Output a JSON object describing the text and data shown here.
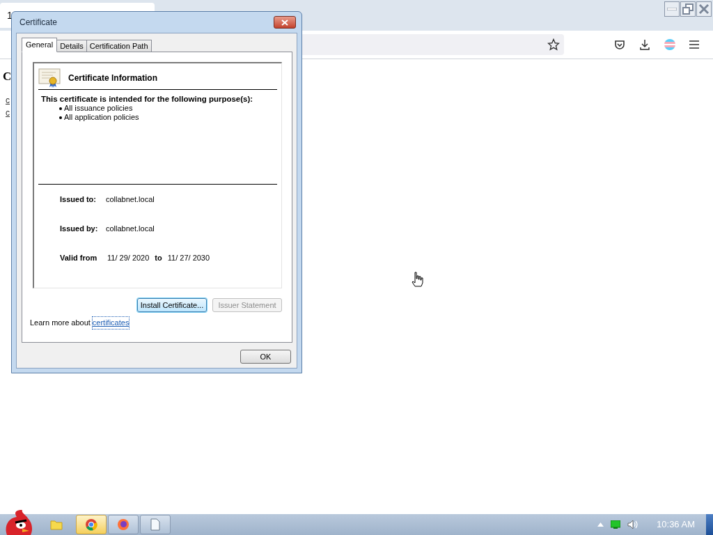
{
  "browser": {
    "tab_title": "1"
  },
  "page": {
    "heading": "C",
    "links": [
      "c",
      "c"
    ]
  },
  "dialog": {
    "title": "Certificate",
    "tabs": [
      {
        "label": "General",
        "selected": true
      },
      {
        "label": "Details",
        "selected": false
      },
      {
        "label": "Certification Path",
        "selected": false
      }
    ],
    "header": "Certificate Information",
    "purpose_heading": "This certificate is intended for the following purpose(s):",
    "purposes": [
      "All issuance policies",
      "All application policies"
    ],
    "fields": [
      {
        "label": "Issued to:",
        "value": "collabnet.local"
      },
      {
        "label": "Issued by:",
        "value": "collabnet.local"
      }
    ],
    "validity": {
      "label": "Valid from",
      "from": "11/ 29/ 2020",
      "to_label": "to",
      "to": "11/ 27/ 2030"
    },
    "buttons": [
      {
        "label": "Install Certificate...",
        "disabled": false,
        "focused": true
      },
      {
        "label": "Issuer Statement",
        "disabled": true,
        "focused": false
      }
    ],
    "learn_more": {
      "text": "Learn more about",
      "link": "certificates"
    },
    "ok": "OK"
  },
  "taskbar": {
    "apps": [
      {
        "kind": "chrome",
        "selected": true
      },
      {
        "kind": "firefox",
        "selected": false
      },
      {
        "kind": "document",
        "selected": false
      }
    ],
    "clock": "10:36 AM"
  }
}
